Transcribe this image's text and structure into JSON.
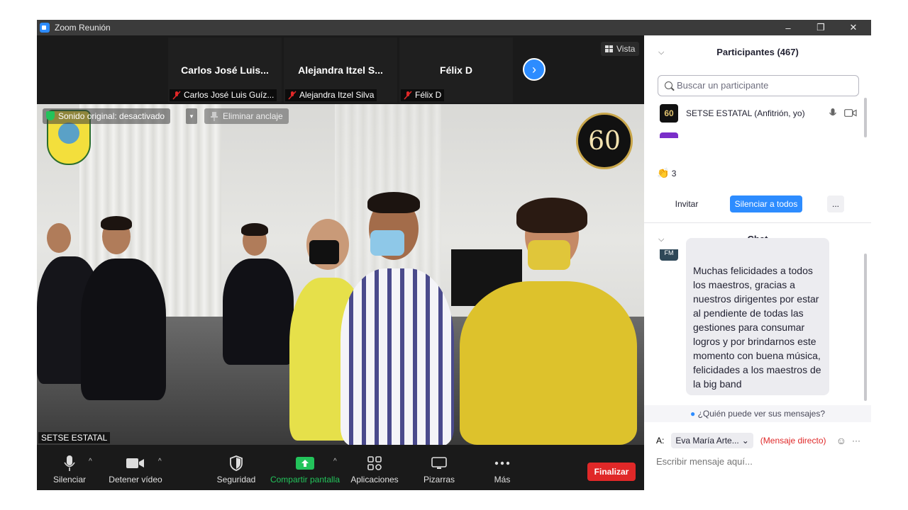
{
  "window": {
    "title": "Zoom Reunión",
    "controls": {
      "minimize": "–",
      "restore": "❐",
      "close": "✕"
    }
  },
  "thumbnails": [
    {
      "name": "Carlos José Luis...",
      "label": "Carlos José Luis Guíz..."
    },
    {
      "name": "Alejandra  Itzel S...",
      "label": "Alejandra Itzel Silva"
    },
    {
      "name": "Félix D",
      "label": "Félix D"
    }
  ],
  "view_button": "Vista",
  "video": {
    "original_sound": "Sonido original: desactivado",
    "unpin": "Eliminar anclaje",
    "speaker": "SETSE ESTATAL",
    "badge_60": "60"
  },
  "toolbar": {
    "mute": "Silenciar",
    "stop_video": "Detener vídeo",
    "security": "Seguridad",
    "share": "Compartir pantalla",
    "apps": "Aplicaciones",
    "whiteboards": "Pizarras",
    "more": "Más",
    "end": "Finalizar"
  },
  "participants": {
    "title": "Participantes (467)",
    "search_placeholder": "Buscar un participante",
    "self_name": "SETSE ESTATAL (Anfitrión, yo)",
    "self_avatar": "60",
    "reaction_count": "3",
    "invite": "Invitar",
    "mute_all": "Silenciar a todos",
    "more": "..."
  },
  "chat": {
    "title": "Chat",
    "sender_initials": "FM",
    "message": "Muchas felicidades a todos los maestros, gracias a nuestros dirigentes por estar al pendiente de todas las gestiones para consumar logros y por brindarnos este momento con buena música, felicidades a los maestros de la big band",
    "who_can_see": "¿Quién puede ver sus mensajes?",
    "to_label": "A:",
    "recipient": "Eva María Arte...",
    "direct": "(Mensaje directo)",
    "input_placeholder": "Escribir mensaje aquí..."
  },
  "colors": {
    "accent": "#2d8cff",
    "share_green": "#23c35b",
    "end_red": "#e02828"
  }
}
